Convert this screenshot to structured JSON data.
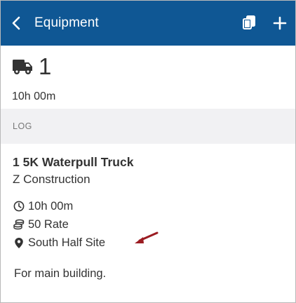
{
  "header": {
    "title": "Equipment",
    "bg_color": "#0f5794",
    "back_icon": "chevron-left-icon",
    "copy_icon": "copy-icon",
    "add_icon": "plus-icon"
  },
  "summary": {
    "icon": "truck-icon",
    "count": "1",
    "duration": "10h 00m"
  },
  "log_section": {
    "label": "LOG"
  },
  "entry": {
    "name": "1 5K Waterpull Truck",
    "company": "Z Construction",
    "duration": "10h 00m",
    "rate": "50 Rate",
    "location": "South Half Site",
    "note": "For main building.",
    "arrow_color": "#9b1c22"
  }
}
